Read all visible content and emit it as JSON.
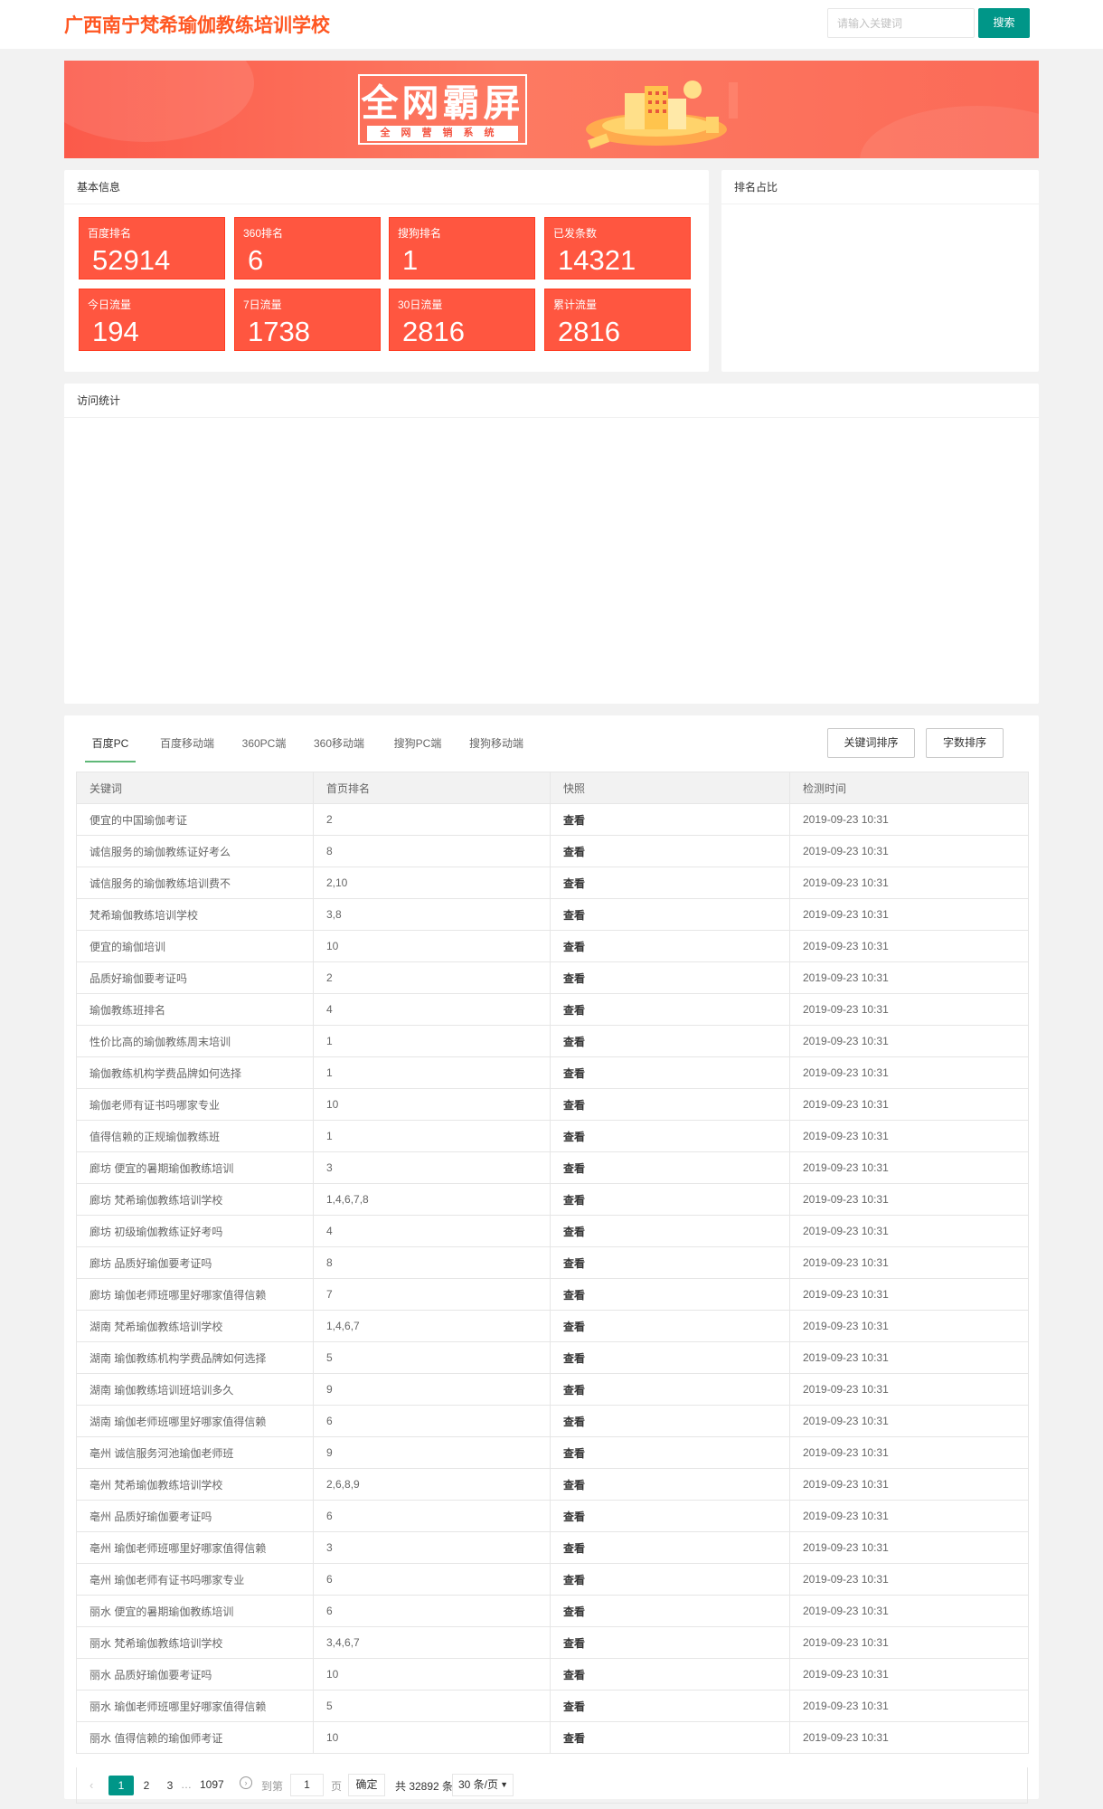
{
  "header": {
    "site_title": "广西南宁梵希瑜伽教练培训学校",
    "search_placeholder": "请输入关键词",
    "search_button": "搜索"
  },
  "banner": {
    "title": "全网霸屏",
    "subtitle": "全网营销系统"
  },
  "basic_info": {
    "title": "基本信息",
    "stats": [
      {
        "label": "百度排名",
        "value": "52914"
      },
      {
        "label": "360排名",
        "value": "6"
      },
      {
        "label": "搜狗排名",
        "value": "1"
      },
      {
        "label": "已发条数",
        "value": "14321"
      },
      {
        "label": "今日流量",
        "value": "194"
      },
      {
        "label": "7日流量",
        "value": "1738"
      },
      {
        "label": "30日流量",
        "value": "2816"
      },
      {
        "label": "累计流量",
        "value": "2816"
      }
    ]
  },
  "ranking_share": {
    "title": "排名占比"
  },
  "visit_stats": {
    "title": "访问统计"
  },
  "keywords": {
    "tabs": [
      "百度PC",
      "百度移动端",
      "360PC端",
      "360移动端",
      "搜狗PC端",
      "搜狗移动端"
    ],
    "active_tab": "百度PC",
    "sort_buttons": [
      "关键词排序",
      "字数排序"
    ],
    "columns": [
      "关键词",
      "首页排名",
      "快照",
      "检测时间"
    ],
    "rows": [
      [
        "便宜的中国瑜伽考证",
        "2",
        "查看",
        "2019-09-23 10:31"
      ],
      [
        "诚信服务的瑜伽教练证好考么",
        "8",
        "查看",
        "2019-09-23 10:31"
      ],
      [
        "诚信服务的瑜伽教练培训费不",
        "2,10",
        "查看",
        "2019-09-23 10:31"
      ],
      [
        "梵希瑜伽教练培训学校",
        "3,8",
        "查看",
        "2019-09-23 10:31"
      ],
      [
        "便宜的瑜伽培训",
        "10",
        "查看",
        "2019-09-23 10:31"
      ],
      [
        "品质好瑜伽要考证吗",
        "2",
        "查看",
        "2019-09-23 10:31"
      ],
      [
        "瑜伽教练班排名",
        "4",
        "查看",
        "2019-09-23 10:31"
      ],
      [
        "性价比高的瑜伽教练周末培训",
        "1",
        "查看",
        "2019-09-23 10:31"
      ],
      [
        "瑜伽教练机构学费品牌如何选择",
        "1",
        "查看",
        "2019-09-23 10:31"
      ],
      [
        "瑜伽老师有证书吗哪家专业",
        "10",
        "查看",
        "2019-09-23 10:31"
      ],
      [
        "值得信赖的正规瑜伽教练班",
        "1",
        "查看",
        "2019-09-23 10:31"
      ],
      [
        "廊坊 便宜的暑期瑜伽教练培训",
        "3",
        "查看",
        "2019-09-23 10:31"
      ],
      [
        "廊坊 梵希瑜伽教练培训学校",
        "1,4,6,7,8",
        "查看",
        "2019-09-23 10:31"
      ],
      [
        "廊坊 初级瑜伽教练证好考吗",
        "4",
        "查看",
        "2019-09-23 10:31"
      ],
      [
        "廊坊 品质好瑜伽要考证吗",
        "8",
        "查看",
        "2019-09-23 10:31"
      ],
      [
        "廊坊 瑜伽老师班哪里好哪家值得信赖",
        "7",
        "查看",
        "2019-09-23 10:31"
      ],
      [
        "湖南 梵希瑜伽教练培训学校",
        "1,4,6,7",
        "查看",
        "2019-09-23 10:31"
      ],
      [
        "湖南 瑜伽教练机构学费品牌如何选择",
        "5",
        "查看",
        "2019-09-23 10:31"
      ],
      [
        "湖南 瑜伽教练培训班培训多久",
        "9",
        "查看",
        "2019-09-23 10:31"
      ],
      [
        "湖南 瑜伽老师班哪里好哪家值得信赖",
        "6",
        "查看",
        "2019-09-23 10:31"
      ],
      [
        "亳州 诚信服务河池瑜伽老师班",
        "9",
        "查看",
        "2019-09-23 10:31"
      ],
      [
        "亳州 梵希瑜伽教练培训学校",
        "2,6,8,9",
        "查看",
        "2019-09-23 10:31"
      ],
      [
        "亳州 品质好瑜伽要考证吗",
        "6",
        "查看",
        "2019-09-23 10:31"
      ],
      [
        "亳州 瑜伽老师班哪里好哪家值得信赖",
        "3",
        "查看",
        "2019-09-23 10:31"
      ],
      [
        "亳州 瑜伽老师有证书吗哪家专业",
        "6",
        "查看",
        "2019-09-23 10:31"
      ],
      [
        "丽水 便宜的暑期瑜伽教练培训",
        "6",
        "查看",
        "2019-09-23 10:31"
      ],
      [
        "丽水 梵希瑜伽教练培训学校",
        "3,4,6,7",
        "查看",
        "2019-09-23 10:31"
      ],
      [
        "丽水 品质好瑜伽要考证吗",
        "10",
        "查看",
        "2019-09-23 10:31"
      ],
      [
        "丽水 瑜伽老师班哪里好哪家值得信赖",
        "5",
        "查看",
        "2019-09-23 10:31"
      ],
      [
        "丽水 值得信赖的瑜伽师考证",
        "10",
        "查看",
        "2019-09-23 10:31"
      ]
    ]
  },
  "pagination": {
    "current": "1",
    "pages": [
      "1",
      "2",
      "3"
    ],
    "ellipsis": "…",
    "last": "1097",
    "goto_label": "到第",
    "goto_value": "1",
    "page_label": "页",
    "confirm": "确定",
    "total": "共 32892 条",
    "page_size": "30 条/页"
  },
  "colors": {
    "accent": "#009688",
    "title_orange": "#ff5722",
    "stat_red": "#ff5640",
    "tab_underline": "#5fb878"
  }
}
